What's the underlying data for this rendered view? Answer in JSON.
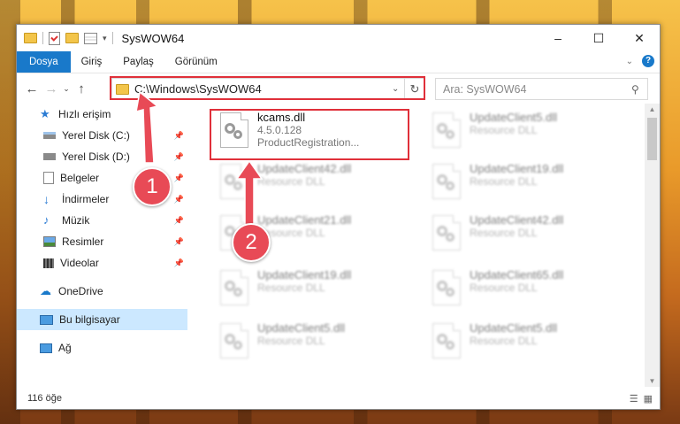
{
  "window": {
    "title": "SysWOW64"
  },
  "ribbon": {
    "tabs": [
      "Dosya",
      "Giriş",
      "Paylaş",
      "Görünüm"
    ]
  },
  "address": {
    "path": "C:\\Windows\\SysWOW64"
  },
  "search": {
    "placeholder": "Ara: SysWOW64"
  },
  "nav": {
    "items": [
      {
        "label": "Hızlı erişim",
        "icon": "star-icon"
      },
      {
        "label": "Yerel Disk (C:)",
        "icon": "drive-icon"
      },
      {
        "label": "Yerel Disk (D:)",
        "icon": "drive-icon"
      },
      {
        "label": "Belgeler",
        "icon": "documents-icon"
      },
      {
        "label": "İndirmeler",
        "icon": "download-icon"
      },
      {
        "label": "Müzik",
        "icon": "music-icon"
      },
      {
        "label": "Resimler",
        "icon": "pictures-icon"
      },
      {
        "label": "Videolar",
        "icon": "videos-icon"
      },
      {
        "label": "OneDrive",
        "icon": "cloud-icon"
      },
      {
        "label": "Bu bilgisayar",
        "icon": "computer-icon"
      },
      {
        "label": "Ağ",
        "icon": "network-icon"
      }
    ]
  },
  "files": [
    {
      "name": "kcams.dll",
      "line2": "4.5.0.128",
      "line3": "ProductRegistration..."
    },
    {
      "name": "UpdateClient5.dll",
      "line2": "Resource DLL"
    },
    {
      "name": "UpdateClient42.dll",
      "line2": "Resource DLL"
    },
    {
      "name": "UpdateClient19.dll",
      "line2": "Resource DLL"
    },
    {
      "name": "UpdateClient21.dll",
      "line2": "Resource DLL"
    },
    {
      "name": "UpdateClient42.dll",
      "line2": "Resource DLL"
    },
    {
      "name": "UpdateClient19.dll",
      "line2": "Resource DLL"
    },
    {
      "name": "UpdateClient65.dll",
      "line2": "Resource DLL"
    },
    {
      "name": "UpdateClient5.dll",
      "line2": "Resource DLL"
    },
    {
      "name": "UpdateClient5.dll",
      "line2": "Resource DLL"
    }
  ],
  "status": {
    "count": "116 öğe"
  },
  "badges": [
    "1",
    "2"
  ]
}
